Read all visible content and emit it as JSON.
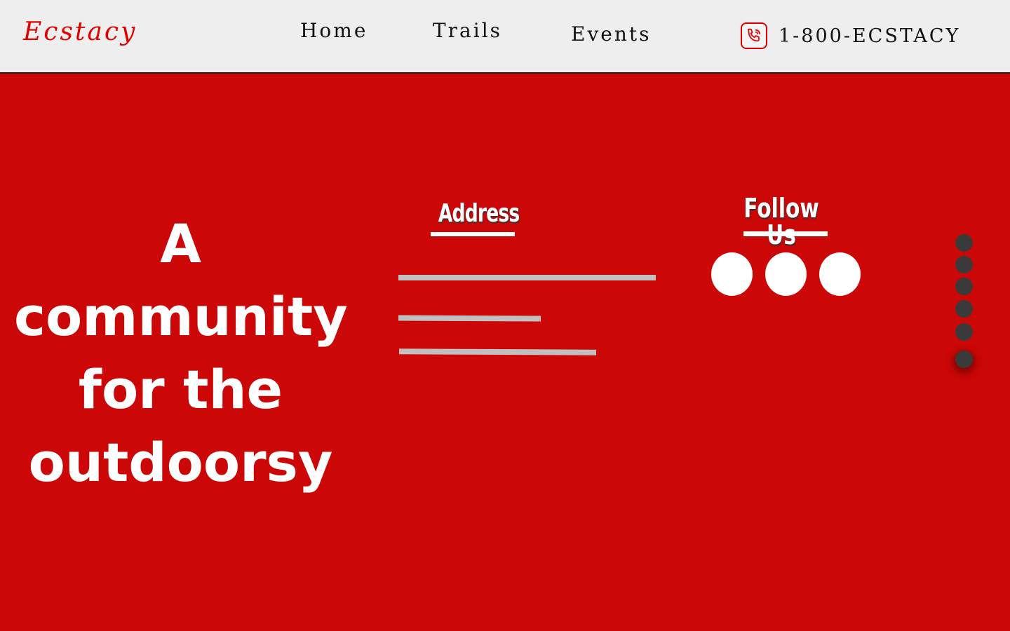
{
  "navbar": {
    "brand": "Ecstacy",
    "links": [
      {
        "label": "Home"
      },
      {
        "label": "Trails"
      },
      {
        "label": "Events"
      }
    ],
    "phone": {
      "icon": "phone-icon",
      "number": "1-800-ECSTACY"
    }
  },
  "hero": {
    "lines": [
      "A",
      "community",
      "for the",
      "outdoorsy"
    ]
  },
  "address": {
    "title": "Address"
  },
  "follow": {
    "title": "Follow Us",
    "icons": [
      "social-icon",
      "social-icon",
      "social-icon"
    ]
  },
  "page_indicator": {
    "count": 6,
    "active_index": 6
  },
  "colors": {
    "background": "#cc0707",
    "navbar": "#eeeeee",
    "brand": "#e00000",
    "dot": "#3a3a3a",
    "placeholder_line": "#c0c0c0"
  }
}
